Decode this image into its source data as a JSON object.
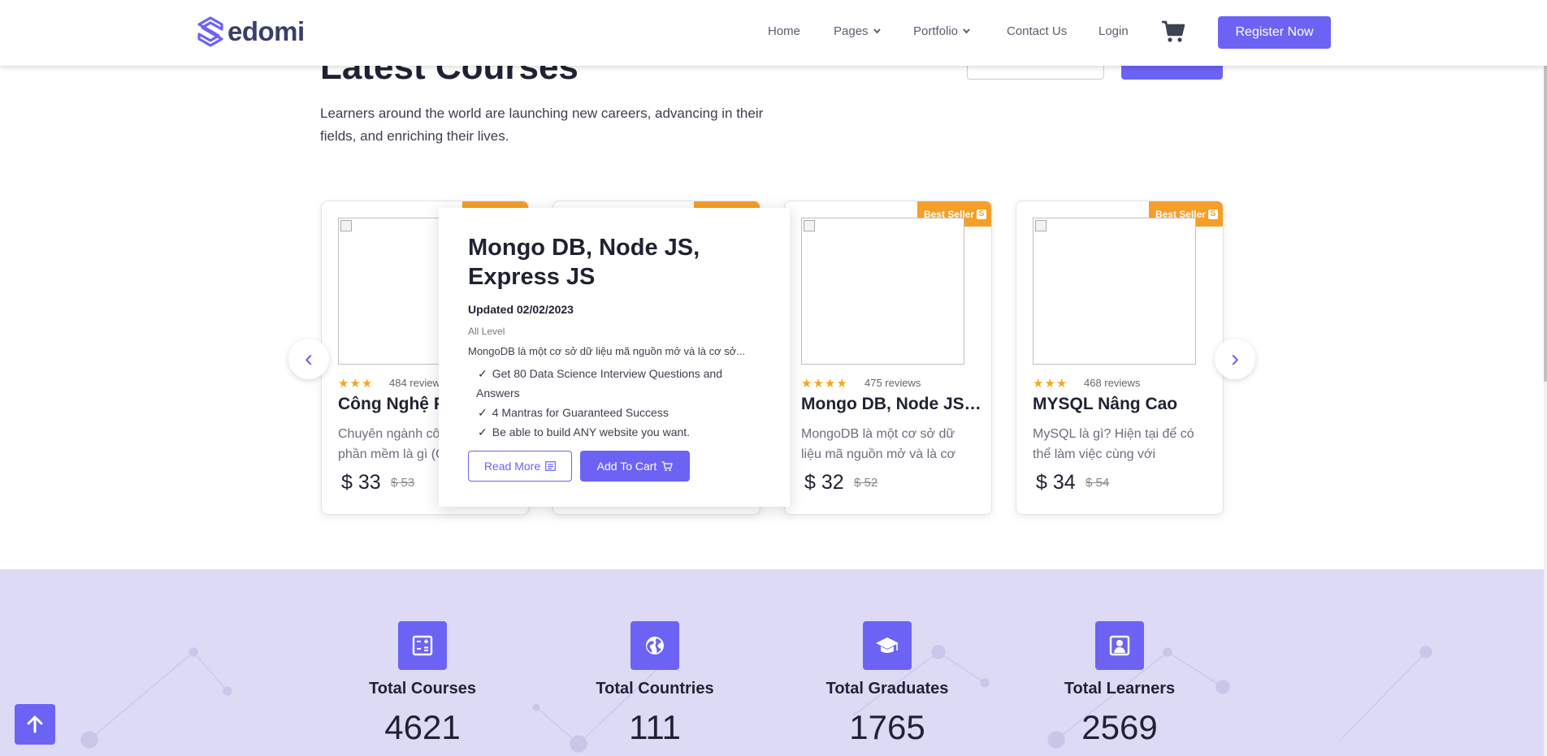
{
  "header": {
    "logo_text": "edomi",
    "nav": [
      {
        "label": "Home",
        "has_dropdown": false
      },
      {
        "label": "Pages",
        "has_dropdown": true
      },
      {
        "label": "Portfolio",
        "has_dropdown": true
      },
      {
        "label": "Contact Us",
        "has_dropdown": false
      },
      {
        "label": "Login",
        "has_dropdown": false
      }
    ],
    "cart_icon": "cart-icon",
    "register_label": "Register Now"
  },
  "section": {
    "title": "Latest Courses",
    "description": "Learners around the world are launching new careers, advancing in their fields, and enriching their lives."
  },
  "cards": [
    {
      "ribbon": "",
      "stars": "★★★",
      "reviews": "484 reviews",
      "title": "Công Nghệ Phần Mềm",
      "desc": "Chuyên ngành công nghệ phần mềm là gì (C",
      "price": "$ 33",
      "old_price": "$ 53"
    },
    {
      "ribbon": "",
      "stars": "",
      "reviews": "",
      "title": "",
      "desc": "",
      "price": "",
      "old_price": ""
    },
    {
      "ribbon": "Best Seller",
      "stars": "★★★★",
      "reviews": "475 reviews",
      "title": "Mongo DB, Node JS, ...",
      "desc": "MongoDB là một cơ sở dữ liệu mã nguồn mở và là cơ",
      "price": "$ 32",
      "old_price": "$ 52"
    },
    {
      "ribbon": "Best Seller",
      "stars": "★★★",
      "reviews": "468 reviews",
      "title": "MYSQL Nâng Cao",
      "desc": "MySQL là gì? Hiện tại để có thể làm việc cùng với",
      "price": "$ 34",
      "old_price": "$ 54"
    }
  ],
  "ribbon_badge": "S",
  "popup": {
    "title": "Mongo DB, Node JS, Express JS",
    "updated": "Updated 02/02/2023",
    "level": "All Level",
    "desc": "MongoDB là một cơ sở dữ liệu mã nguồn mở và là cơ sở...",
    "points": [
      "Get 80 Data Science Interview Questions and Answers",
      "4 Mantras for Guaranteed Success",
      "Be able to build ANY website you want."
    ],
    "read_more": "Read More",
    "add_to_cart": "Add To Cart"
  },
  "carousel": {
    "prev": "‹",
    "next": "›"
  },
  "stats": [
    {
      "label": "Total Courses",
      "value": "4621",
      "icon": "calculator-icon"
    },
    {
      "label": "Total Countries",
      "value": "111",
      "icon": "globe-icon"
    },
    {
      "label": "Total Graduates",
      "value": "1765",
      "icon": "graduation-cap-icon"
    },
    {
      "label": "Total Learners",
      "value": "2569",
      "icon": "user-portrait-icon"
    }
  ],
  "colors": {
    "accent": "#6c63f5",
    "ribbon": "#f59f28",
    "star": "#f5a623",
    "stats_bg": "#dcdaf4"
  }
}
